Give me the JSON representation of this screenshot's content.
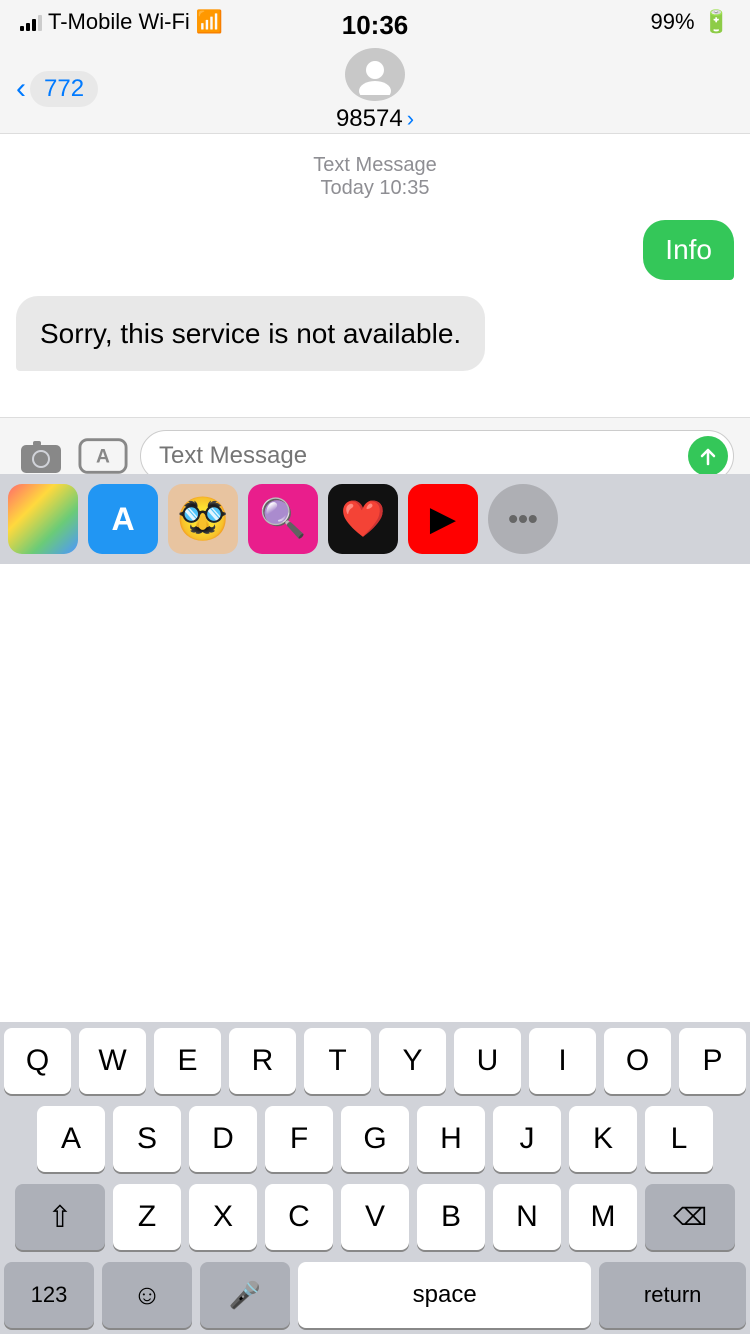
{
  "statusBar": {
    "carrier": "T-Mobile Wi-Fi",
    "time": "10:36",
    "battery": "99%"
  },
  "header": {
    "backLabel": "772",
    "contactName": "98574",
    "avatarAlt": "contact avatar"
  },
  "chat": {
    "messageType": "Text Message",
    "timestamp": "Today 10:35",
    "sentMessage": "Info",
    "receivedMessage": "Sorry, this service is not available."
  },
  "inputBar": {
    "placeholder": "Text Message"
  },
  "keyboard": {
    "row1": [
      "Q",
      "W",
      "E",
      "R",
      "T",
      "Y",
      "U",
      "I",
      "O",
      "P"
    ],
    "row2": [
      "A",
      "S",
      "D",
      "F",
      "G",
      "H",
      "J",
      "K",
      "L"
    ],
    "row3": [
      "Z",
      "X",
      "C",
      "V",
      "B",
      "N",
      "M"
    ],
    "spaceLabel": "space",
    "returnLabel": "return",
    "numbersLabel": "123"
  }
}
